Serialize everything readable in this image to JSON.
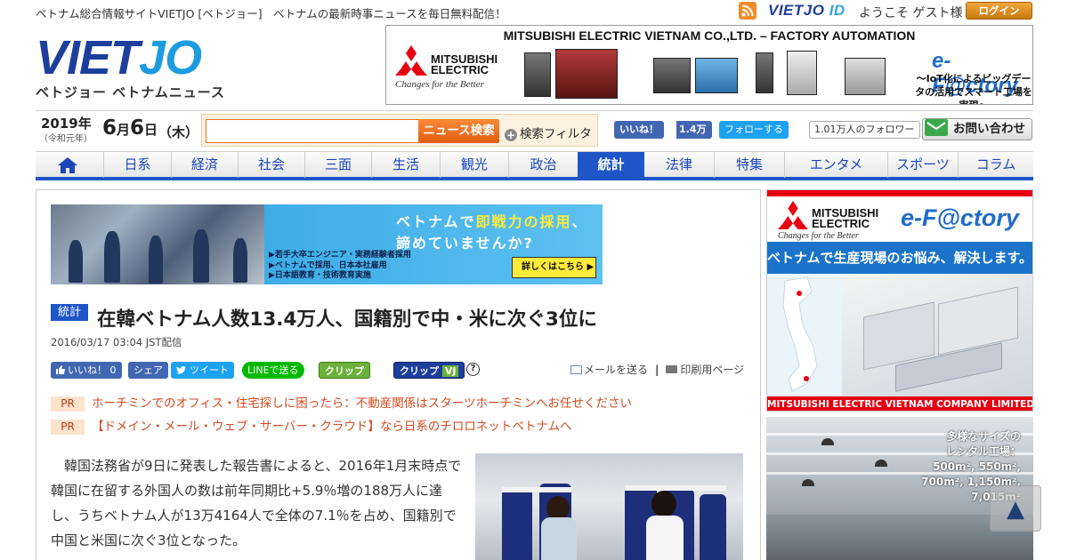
{
  "topbar": {
    "tagline": "ベトナム総合情報サイトVIETJO [ベトジョー]　ベトナムの最新時事ニュースを毎日無料配信！",
    "vietjo_id_a": "VIETJO ",
    "vietjo_id_b": "ID",
    "welcome": "ようこそ ゲスト様",
    "login": "ログイン"
  },
  "logo": {
    "word_a": "VIET",
    "word_b": "JO",
    "sub": "ベトジョー ベトナムニュース"
  },
  "header_ad": {
    "title": "MITSUBISHI ELECTRIC VIETNAM CO.,LTD. – FACTORY AUTOMATION",
    "brand_line1": "MITSUBISHI",
    "brand_line2": "ELECTRIC",
    "slogan": "Changes for the Better",
    "efactory": "e-F@ctory",
    "efactory_sub": "～IoT化によるビッグデータの活用でスマート工場を実現～"
  },
  "date": {
    "year": "2019年",
    "era": "（令和元年）",
    "month": "6",
    "month_unit": "月",
    "day": "6",
    "day_unit": "日",
    "weekday": "（木）"
  },
  "search": {
    "placeholder": "",
    "button": "ニュース検索",
    "filter_icon": "+",
    "filter": "検索フィルタ"
  },
  "social_header": {
    "fb_like": "いいね！",
    "fb_count": "1.4万",
    "tw_follow": "フォローする",
    "tw_count": "1.01万人のフォロワー",
    "contact": "お問い合わせ"
  },
  "nav": {
    "items": [
      "日系",
      "経済",
      "社会",
      "三面",
      "生活",
      "観光",
      "政治",
      "統計",
      "法律",
      "特集",
      "エンタメ",
      "スポーツ",
      "コラム"
    ],
    "active": "統計"
  },
  "banner": {
    "line1_a": "ベトナムで",
    "line1_b": "即戦力の採用",
    "line1_c": "、",
    "line2": "諦めていませんか?",
    "bullet1": "▶若手大卒エンジニア・実務経験者採用",
    "bullet2": "▶ベトナムで採用、日本本社雇用",
    "bullet3": "▶日本語教育・技術教育実施",
    "more": "詳しくはこちら ▶"
  },
  "article": {
    "category": "統計",
    "headline": "在韓ベトナム人数13.4万人、国籍別で中・米に次ぐ3位に",
    "published": "2016/03/17 03:04 JST配信",
    "body": "　韓国法務省が9日に発表した報告書によると、2016年1月末時点で韓国に在留する外国人の数は前年同期比+5.9％増の188万人に達し、うちベトナム人が13万4164人で全体の7.1％を占め、国籍別で中国と米国に次ぐ3位となった。"
  },
  "share": {
    "like": "いいね！ 0",
    "share": "シェア",
    "tweet": "ツイート",
    "line": "LINEで送る",
    "clip": "クリップ",
    "clip_vj": "クリップ",
    "clip_vj_mark": "VJ",
    "help": "?",
    "mail": "メールを送る",
    "divider": "|",
    "print": "印刷用ページ"
  },
  "pr": [
    {
      "tag": "PR",
      "text": "ホーチミンでのオフィス・住宅探しに困ったら：不動産関係はスターツホーチミンへお任せください"
    },
    {
      "tag": "PR",
      "text": "【ドメイン・メール・ウェブ・サーバー・クラウド】なら日系のチロロネットベトナムへ"
    }
  ],
  "side_ad1": {
    "brand_line1": "MITSUBISHI",
    "brand_line2": "ELECTRIC",
    "slogan": "Changes for the Better",
    "efactory": "e-F@ctory",
    "tagline": "ベトナムで生産現場のお悩み、解決します。",
    "footer": "MITSUBISHI ELECTRIC VIETNAM COMPANY LIMITED"
  },
  "side_ad2": {
    "text": "多様なサイズの\nレンタル工場：\n500m², 550m²,\n700m², 1,150m²,\n7,015m²"
  },
  "totop": "▲",
  "colors": {
    "brand_blue": "#1d3f9c",
    "nav_active": "#1e55c7",
    "search_orange": "#e35d10",
    "pr_red": "#d24a1f",
    "mitsubishi_red": "#e60012"
  }
}
